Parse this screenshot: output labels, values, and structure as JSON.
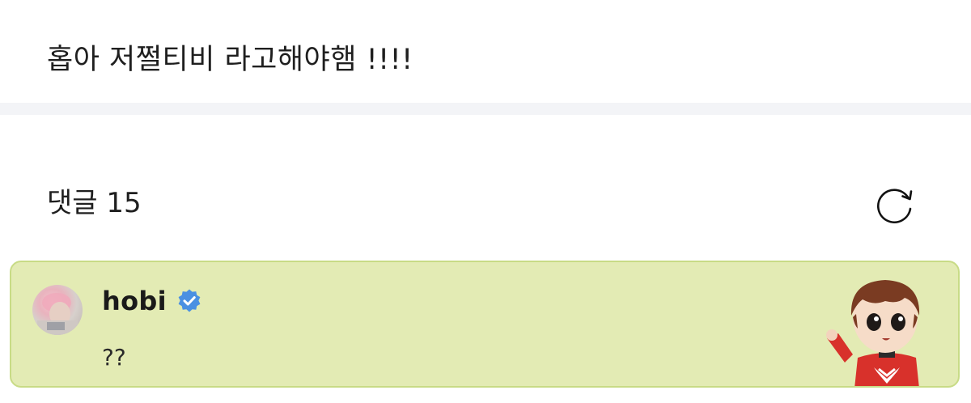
{
  "post": {
    "text": "홉아 저쩔티비 라고해야햄 !!!!"
  },
  "comments": {
    "header_label": "댓글 15",
    "refresh_icon": "refresh-icon"
  },
  "comment": {
    "username": "hobi",
    "verified_icon": "verified-badge-icon",
    "body": "??",
    "card_color": "#e3ebb4",
    "card_border_color": "#c8db86"
  },
  "colors": {
    "verified_badge": "#4a90e2",
    "divider": "#f3f4f7"
  }
}
